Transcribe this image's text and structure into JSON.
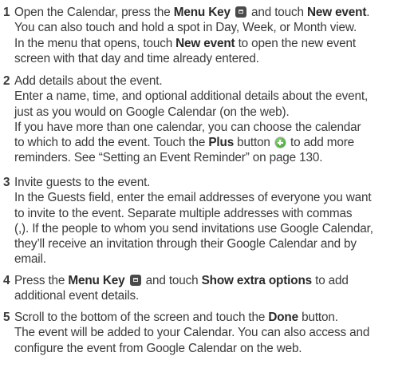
{
  "steps": [
    {
      "number": "1",
      "lines": [
        [
          "Open the Calendar, press the ",
          "Menu Key",
          " and touch ",
          "New event",
          "."
        ],
        [
          "You can also touch and hold a spot in Day, Week, or Month view."
        ],
        [
          "In the menu that opens, touch ",
          "New event",
          " to open the new event"
        ],
        [
          "screen with that day and time already entered."
        ]
      ]
    },
    {
      "number": "2",
      "lines": [
        [
          "Add details about the event."
        ],
        [
          "Enter a name, time, and optional additional details about the event,"
        ],
        [
          "just as you would on Google Calendar (on the web)."
        ],
        [
          "If you have more than one calendar, you can choose the calendar"
        ],
        [
          "to which to add the event. Touch the ",
          "Plus",
          " button",
          "to add more"
        ],
        [
          "reminders. See “Setting an Event Reminder” on page 130."
        ]
      ]
    },
    {
      "number": "3",
      "lines": [
        [
          "Invite guests to the event."
        ],
        [
          "In the Guests field, enter the email addresses of everyone you want"
        ],
        [
          "to invite to the event. Separate multiple addresses with commas"
        ],
        [
          "(,). If the people to whom you send invitations use Google Calendar,"
        ],
        [
          "they’ll receive an invitation through their Google Calendar and by"
        ],
        [
          "email."
        ]
      ]
    },
    {
      "number": "4",
      "lines": [
        [
          "Press the ",
          "Menu Key",
          "and touch ",
          "Show extra options",
          " to add"
        ],
        [
          "additional event details."
        ]
      ]
    },
    {
      "number": "5",
      "lines": [
        [
          "Scroll to the bottom of the screen and touch the ",
          "Done",
          " button."
        ],
        [
          "The event will be added to your Calendar. You can also access and"
        ],
        [
          "configure the event from Google Calendar on the web."
        ]
      ]
    }
  ],
  "icons": {
    "menu_key": "menu-key-icon",
    "plus": "plus-button-icon"
  }
}
